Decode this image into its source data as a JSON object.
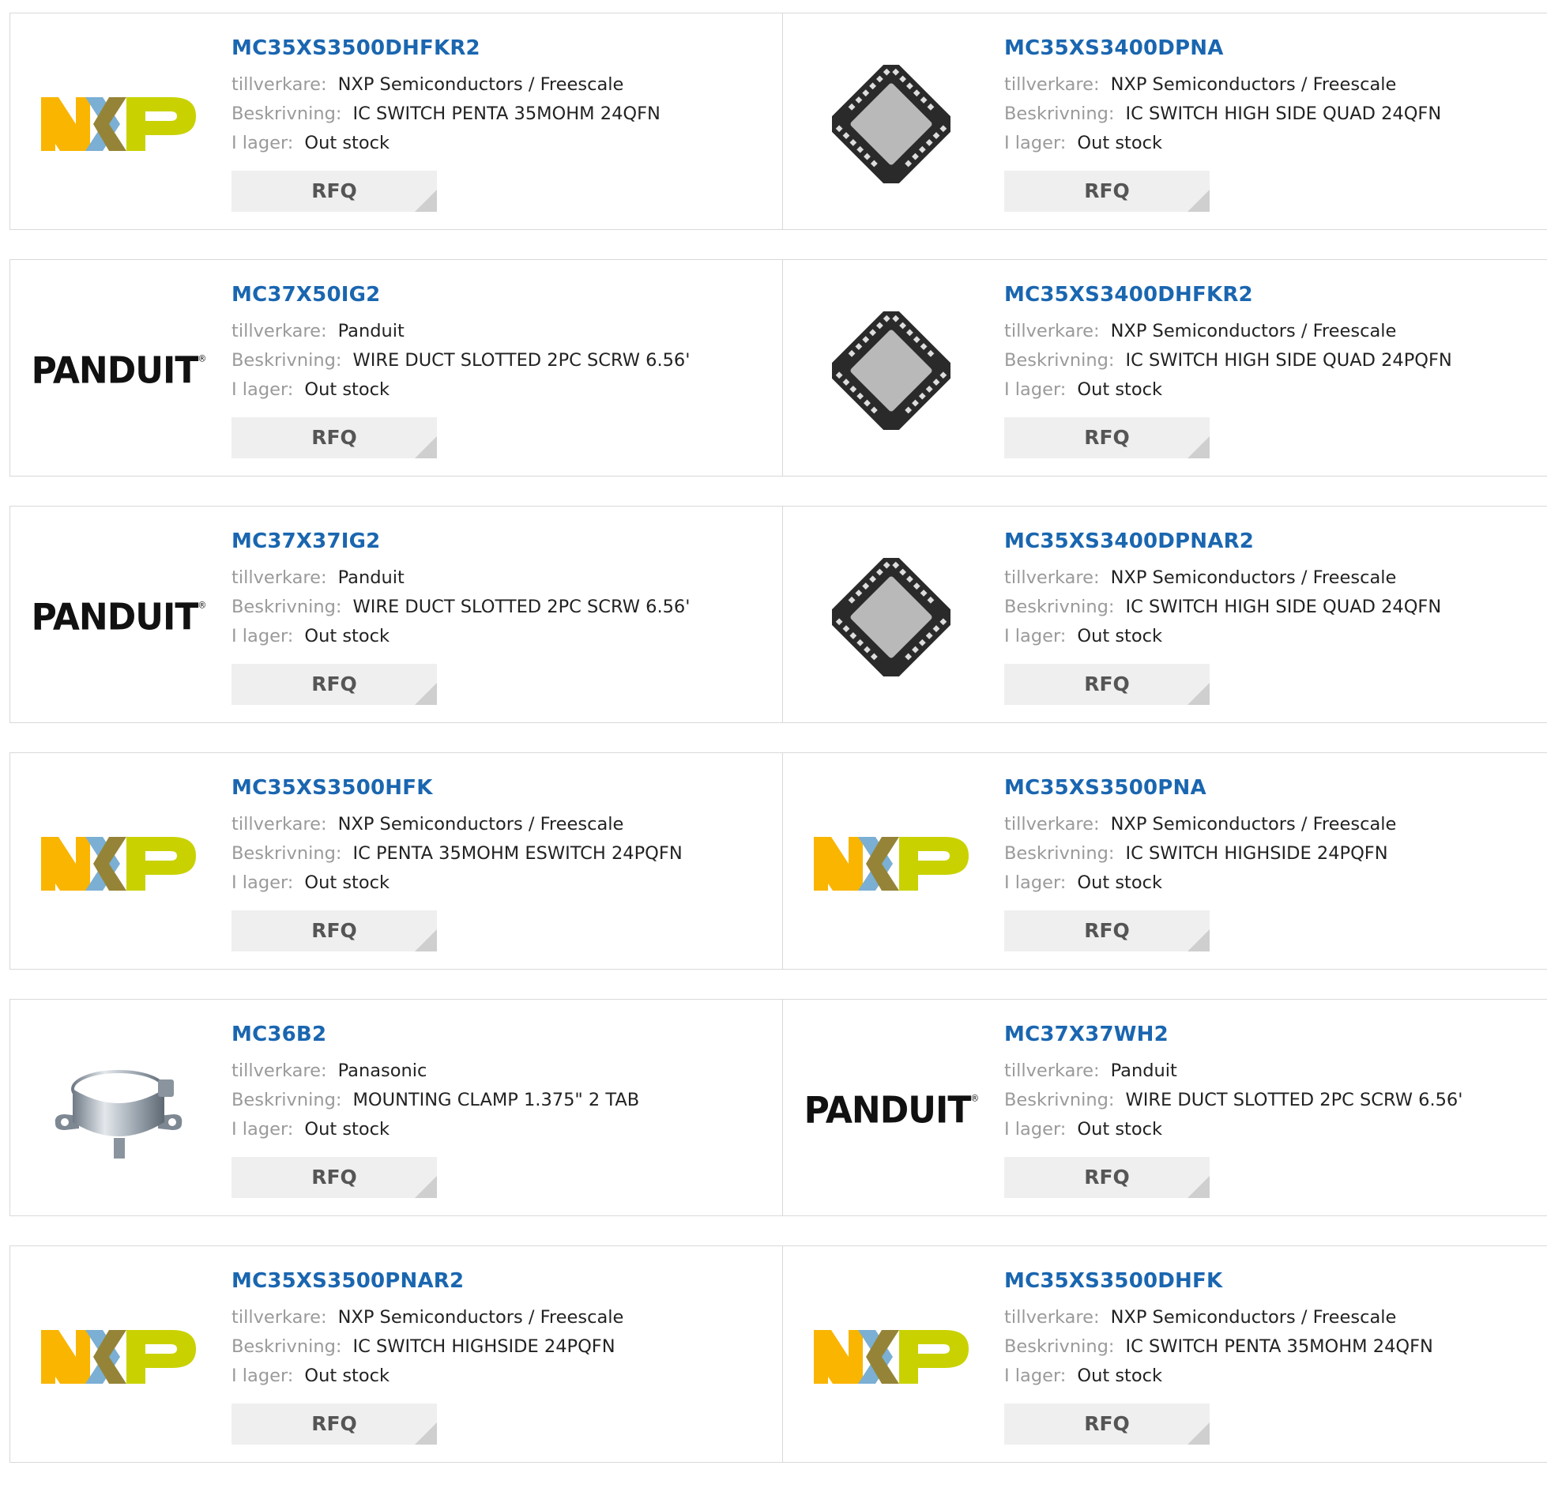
{
  "labels": {
    "manufacturer": "tillverkare:",
    "description": "Beskrivning:",
    "stock": "I lager:",
    "rfq": "RFQ"
  },
  "logo_text": {
    "panduit": "PANDUIT"
  },
  "colors": {
    "part_link": "#1a66b0",
    "label": "#9a9a9a",
    "rfq_bg": "#efefef"
  },
  "products": [
    {
      "part": "MC35XS3500DHFKR2",
      "manufacturer": "NXP Semiconductors / Freescale",
      "description": "IC SWITCH PENTA 35MOHM 24QFN",
      "stock": "Out stock",
      "image": "nxp-logo"
    },
    {
      "part": "MC35XS3400DPNA",
      "manufacturer": "NXP Semiconductors / Freescale",
      "description": "IC SWITCH HIGH SIDE QUAD 24QFN",
      "stock": "Out stock",
      "image": "qfn-chip"
    },
    {
      "part": "MC37X50IG2",
      "manufacturer": "Panduit",
      "description": "WIRE DUCT SLOTTED 2PC SCRW 6.56'",
      "stock": "Out stock",
      "image": "panduit-logo"
    },
    {
      "part": "MC35XS3400DHFKR2",
      "manufacturer": "NXP Semiconductors / Freescale",
      "description": "IC SWITCH HIGH SIDE QUAD 24PQFN",
      "stock": "Out stock",
      "image": "qfn-chip"
    },
    {
      "part": "MC37X37IG2",
      "manufacturer": "Panduit",
      "description": "WIRE DUCT SLOTTED 2PC SCRW 6.56'",
      "stock": "Out stock",
      "image": "panduit-logo"
    },
    {
      "part": "MC35XS3400DPNAR2",
      "manufacturer": "NXP Semiconductors / Freescale",
      "description": "IC SWITCH HIGH SIDE QUAD 24QFN",
      "stock": "Out stock",
      "image": "qfn-chip"
    },
    {
      "part": "MC35XS3500HFK",
      "manufacturer": "NXP Semiconductors / Freescale",
      "description": "IC PENTA 35MOHM ESWITCH 24PQFN",
      "stock": "Out stock",
      "image": "nxp-logo"
    },
    {
      "part": "MC35XS3500PNA",
      "manufacturer": "NXP Semiconductors / Freescale",
      "description": "IC SWITCH HIGHSIDE 24PQFN",
      "stock": "Out stock",
      "image": "nxp-logo"
    },
    {
      "part": "MC36B2",
      "manufacturer": "Panasonic",
      "description": "MOUNTING CLAMP 1.375\" 2 TAB",
      "stock": "Out stock",
      "image": "clamp-photo"
    },
    {
      "part": "MC37X37WH2",
      "manufacturer": "Panduit",
      "description": "WIRE DUCT SLOTTED 2PC SCRW 6.56'",
      "stock": "Out stock",
      "image": "panduit-logo"
    },
    {
      "part": "MC35XS3500PNAR2",
      "manufacturer": "NXP Semiconductors / Freescale",
      "description": "IC SWITCH HIGHSIDE 24PQFN",
      "stock": "Out stock",
      "image": "nxp-logo"
    },
    {
      "part": "MC35XS3500DHFK",
      "manufacturer": "NXP Semiconductors / Freescale",
      "description": "IC SWITCH PENTA 35MOHM 24QFN",
      "stock": "Out stock",
      "image": "nxp-logo"
    }
  ]
}
